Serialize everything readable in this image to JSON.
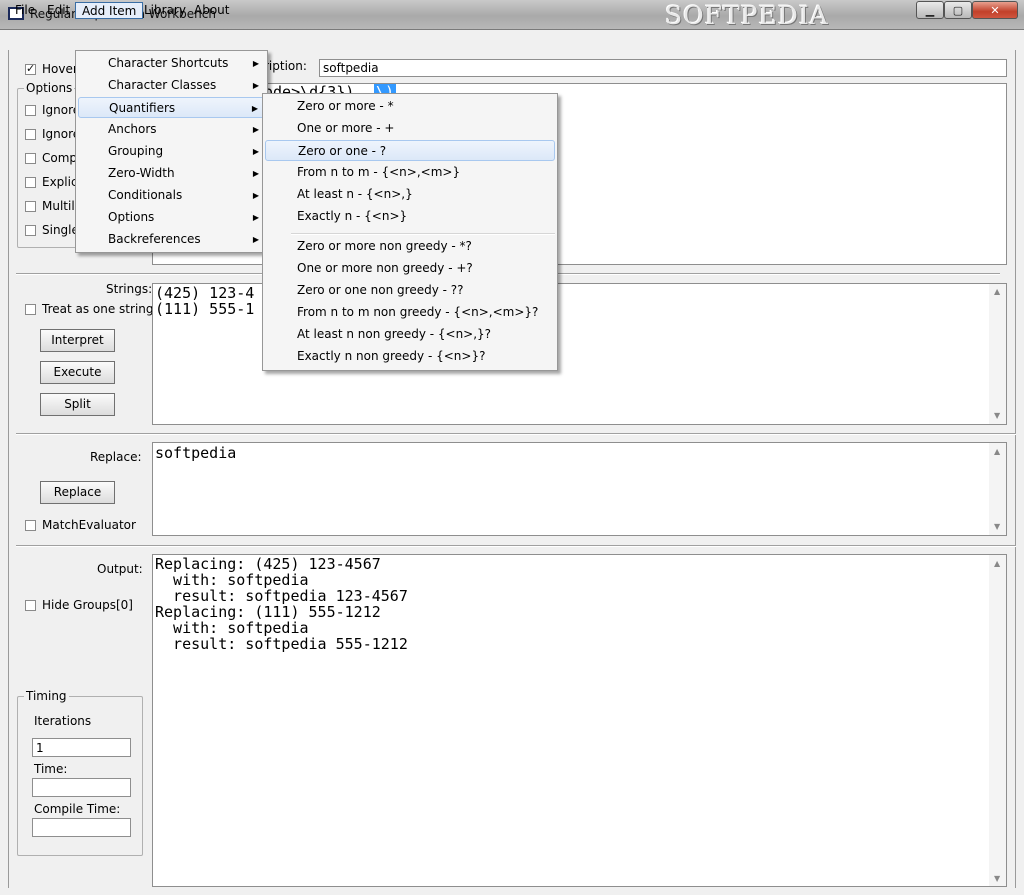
{
  "window": {
    "title": "Regular Expression Workbench",
    "watermark": "SOFTPEDIA",
    "min_glyph": "▁",
    "max_glyph": "▢",
    "close_glyph": "✕"
  },
  "menubar": [
    "File",
    "Edit",
    "Add Item",
    "Library",
    "About"
  ],
  "add_item_menu": [
    "Character Shortcuts",
    "Character Classes",
    "Quantifiers",
    "Anchors",
    "Grouping",
    "Zero-Width",
    "Conditionals",
    "Options",
    "Backreferences"
  ],
  "quantifiers_menu": {
    "greedy": [
      "Zero or more - *",
      "One or more - +",
      "Zero or one - ?",
      "From n to m - {<n>,<m>}",
      "At least n - {<n>,}",
      "Exactly n - {<n>}"
    ],
    "non_greedy": [
      "Zero or more non greedy - *?",
      "One or more non greedy - +?",
      "Zero or one non greedy - ??",
      "From n to m non greedy - {<n>,<m>}?",
      "At least n non greedy - {<n>,}?",
      "Exactly n non greedy - {<n>}?"
    ]
  },
  "top": {
    "hover_label": "Hover",
    "options_title": "Options",
    "options": [
      "Ignore",
      "Ignore",
      "Compi",
      "Explic",
      "Multili",
      "Single"
    ],
    "description_label": "ription:",
    "description_value": "softpedia",
    "regex_partial": "ode>\\d{3})",
    "regex_selected": "\\)"
  },
  "strings": {
    "label": "Strings:",
    "treat_label": "Treat as one string",
    "interpret": "Interpret",
    "execute": "Execute",
    "split": "Split",
    "text": "(425) 123-4\n(111) 555-1"
  },
  "replace": {
    "label": "Replace:",
    "button": "Replace",
    "matchevaluator": "MatchEvaluator",
    "text": "softpedia"
  },
  "output": {
    "label": "Output:",
    "hide_groups": "Hide Groups[0]",
    "text": "Replacing: (425) 123-4567\n  with: softpedia\n  result: softpedia 123-4567\nReplacing: (111) 555-1212\n  with: softpedia\n  result: softpedia 555-1212"
  },
  "timing": {
    "title": "Timing",
    "iterations_label": "Iterations",
    "iterations_value": "1",
    "time_label": "Time:",
    "time_value": "",
    "compile_label": "Compile Time:",
    "compile_value": ""
  },
  "scroll": {
    "up": "▲",
    "down": "▼"
  }
}
